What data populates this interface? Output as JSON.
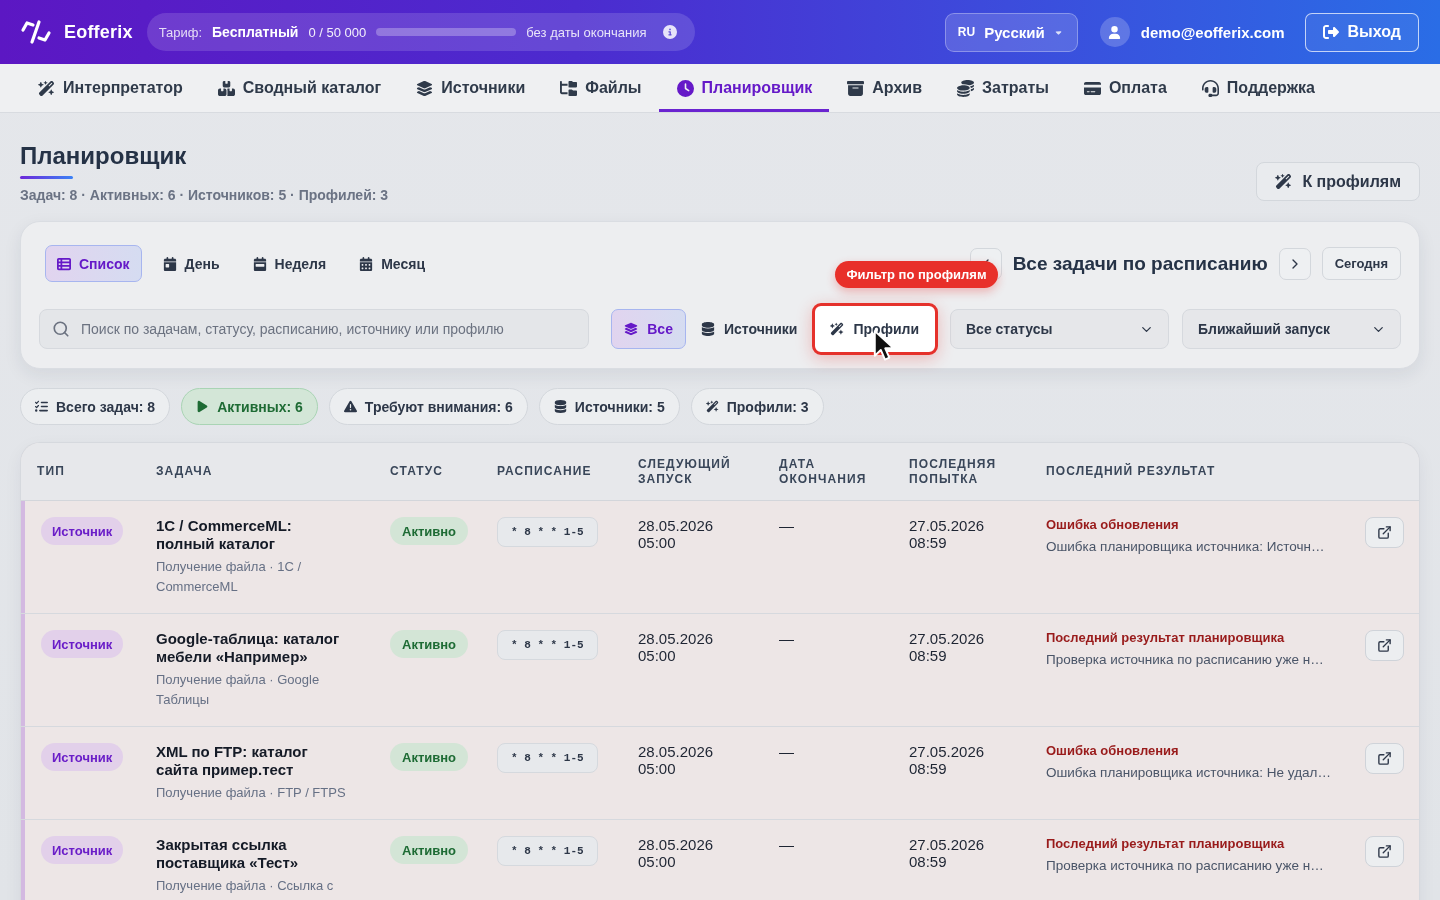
{
  "header": {
    "brand": "Eofferix",
    "plan": {
      "label": "Тариф:",
      "name": "Бесплатный",
      "usage": "0 / 50 000",
      "level": 0,
      "expiry": "без даты окончания"
    },
    "language": {
      "code": "RU",
      "name": "Русский"
    },
    "user": {
      "email": "demo@eofferix.com"
    },
    "logout": "Выход"
  },
  "nav": [
    {
      "label": "Интерпретатор",
      "selected": false
    },
    {
      "label": "Сводный каталог",
      "selected": false
    },
    {
      "label": "Источники",
      "selected": false
    },
    {
      "label": "Файлы",
      "selected": false
    },
    {
      "label": "Планировщик",
      "selected": true
    },
    {
      "label": "Архив",
      "selected": false
    },
    {
      "label": "Затраты",
      "selected": false
    },
    {
      "label": "Оплата",
      "selected": false
    },
    {
      "label": "Поддержка",
      "selected": false
    }
  ],
  "page": {
    "title": "Планировщик",
    "summary": "Задач: 8 · Активных: 6 · Источников: 5 · Профилей: 3",
    "profiles_button": "К профилям"
  },
  "toolbar": {
    "views": [
      {
        "label": "Список",
        "selected": true
      },
      {
        "label": "День",
        "selected": false
      },
      {
        "label": "Неделя",
        "selected": false
      },
      {
        "label": "Месяц",
        "selected": false
      }
    ],
    "period_title": "Все задачи по расписанию",
    "today_button": "Сегодня",
    "search": {
      "placeholder": "Поиск по задачам, статусу, расписанию, источнику или профилю"
    },
    "filters": [
      {
        "label": "Все",
        "selected": true,
        "highlighted": false
      },
      {
        "label": "Источники",
        "selected": false,
        "highlighted": false
      },
      {
        "label": "Профили",
        "selected": false,
        "highlighted": true,
        "tooltip": "Фильтр по профилям"
      }
    ],
    "status_select": "Все статусы",
    "sort_select": "Ближайший запуск"
  },
  "stats": [
    {
      "label": "Всего задач: 8",
      "selected": false
    },
    {
      "label": "Активных: 6",
      "selected": true
    },
    {
      "label": "Требуют внимания: 6",
      "selected": false
    },
    {
      "label": "Источники: 5",
      "selected": false
    },
    {
      "label": "Профили: 3",
      "selected": false
    }
  ],
  "table": {
    "columns": [
      "ТИП",
      "ЗАДАЧА",
      "СТАТУС",
      "РАСПИСАНИЕ",
      "СЛЕДУЮЩИЙ ЗАПУСК",
      "ДАТА ОКОНЧАНИЯ",
      "ПОСЛЕДНЯЯ ПОПЫТКА",
      "ПОСЛЕДНИЙ РЕЗУЛЬТАТ"
    ],
    "rows": [
      {
        "type": "Источник",
        "title": "1C / CommerceML: полный каталог",
        "subtitle": "Получение файла · 1C / CommerceML",
        "status": "Активно",
        "schedule": "* 8 * * 1-5",
        "next_run": "28.05.2026 05:00",
        "end_date": "—",
        "last_attempt": "27.05.2026 08:59",
        "result_title": "Ошибка обновления",
        "result_detail": "Ошибка планировщика источника: Источн…"
      },
      {
        "type": "Источник",
        "title": "Google-таблица: каталог мебели «Например»",
        "subtitle": "Получение файла · Google Таблицы",
        "status": "Активно",
        "schedule": "* 8 * * 1-5",
        "next_run": "28.05.2026 05:00",
        "end_date": "—",
        "last_attempt": "27.05.2026 08:59",
        "result_title": "Последний результат планировщика",
        "result_detail": "Проверка источника по расписанию уже н…"
      },
      {
        "type": "Источник",
        "title": "XML по FTP: каталог сайта пример.тест",
        "subtitle": "Получение файла · FTP / FTPS",
        "status": "Активно",
        "schedule": "* 8 * * 1-5",
        "next_run": "28.05.2026 05:00",
        "end_date": "—",
        "last_attempt": "27.05.2026 08:59",
        "result_title": "Ошибка обновления",
        "result_detail": "Ошибка планировщика источника: Не удал…"
      },
      {
        "type": "Источник",
        "title": "Закрытая ссылка поставщика «Тест»",
        "subtitle": "Получение файла · Ссылка с",
        "status": "Активно",
        "schedule": "* 8 * * 1-5",
        "next_run": "28.05.2026 05:00",
        "end_date": "—",
        "last_attempt": "27.05.2026 08:59",
        "result_title": "Последний результат планировщика",
        "result_detail": "Проверка источника по расписанию уже н…"
      }
    ]
  }
}
